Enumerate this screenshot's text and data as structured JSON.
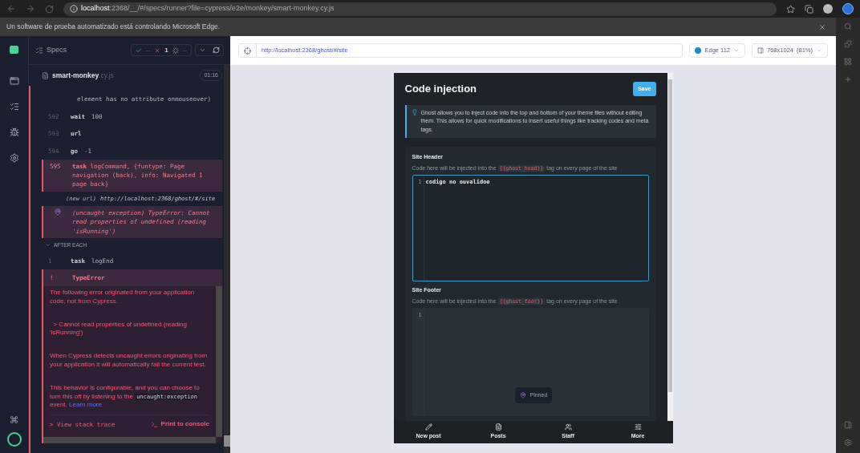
{
  "browser": {
    "url_host": "localhost",
    "url_rest": ":2368/__/#/specs/runner?file=cypress/e2e/monkey/smart-monkey.cy.js",
    "infobar": "Un software de prueba automatizado está controlando Microsoft Edge."
  },
  "reporter": {
    "title": "Specs",
    "passed": "--",
    "failed": "1",
    "pending": "--",
    "spec_name": "smart-monkey",
    "spec_ext": ".cy.js",
    "duration": "01:16",
    "commands": [
      {
        "kind": "cont",
        "text": "element has no attribute onmouseover)"
      },
      {
        "kind": "cmd",
        "num": "592",
        "name": "wait",
        "arg": "100"
      },
      {
        "kind": "cmd",
        "num": "593",
        "name": "url"
      },
      {
        "kind": "cmd",
        "num": "594",
        "name": "go",
        "arg": "-1"
      },
      {
        "kind": "failed",
        "num": "595",
        "name": "task",
        "arg": "logCommand, {funtype: Page navigation (back), info: Navigated 1 page back}"
      },
      {
        "kind": "event",
        "name": "(new url)",
        "arg": "http://localhost:2368/ghost/#/site"
      },
      {
        "kind": "exception",
        "name": "(uncaught exception)",
        "arg": "TypeError: Cannot read properties of undefined (reading 'isRunning')"
      }
    ],
    "hook": {
      "title": "AFTER EACH",
      "expanded": true
    },
    "hook_commands": [
      {
        "num": "1",
        "name": "task",
        "arg": "logEnd"
      }
    ],
    "error": {
      "num": "!",
      "name": "TypeError",
      "paragraphs": [
        "The following error originated from your application code, not from Cypress.",
        "  > Cannot read properties of undefined (reading 'isRunning')",
        "When Cypress detects uncaught errors originating from your application it will automatically fail the current test."
      ],
      "last_before": "This behavior is configurable, and you can choose to turn this off by listening to the",
      "last_code": "uncaught:exception",
      "last_after": "event.",
      "link": "Learn more",
      "stack_trace": "> View stack trace",
      "print": "Print to console"
    }
  },
  "aut": {
    "url": "http://localhost:2368/ghost/#/site",
    "browser": "Edge 112",
    "viewport": "768x1024",
    "scale": "(81%)"
  },
  "ghost": {
    "title": "Code injection",
    "save": "Save",
    "notice": "Ghost allows you to inject code into the top and bottom of your theme files without editing them. This allows for quick modifications to insert useful things like tracking codes and meta tags.",
    "sections": [
      {
        "title": "Site Header",
        "hint_before": "Code here will be injected into the",
        "tag": "{{ghost_head}}",
        "hint_after": "tag on every page of the site",
        "focused": true,
        "lines": [
          {
            "number": "1",
            "code": "codigo no ouvalidoe"
          }
        ]
      },
      {
        "title": "Site Footer",
        "hint_before": "Code here will be injected into the",
        "tag": "{{ghost_foot}}",
        "hint_after": "tag on every page of the site",
        "focused": false,
        "lines": [
          {
            "number": "1"
          }
        ]
      }
    ],
    "pinned": "Pinned",
    "nav": [
      {
        "label": "New post",
        "kind": "pen"
      },
      {
        "label": "Posts",
        "kind": "posts"
      },
      {
        "label": "Staff",
        "kind": "staff"
      },
      {
        "label": "More",
        "kind": "more"
      }
    ]
  }
}
